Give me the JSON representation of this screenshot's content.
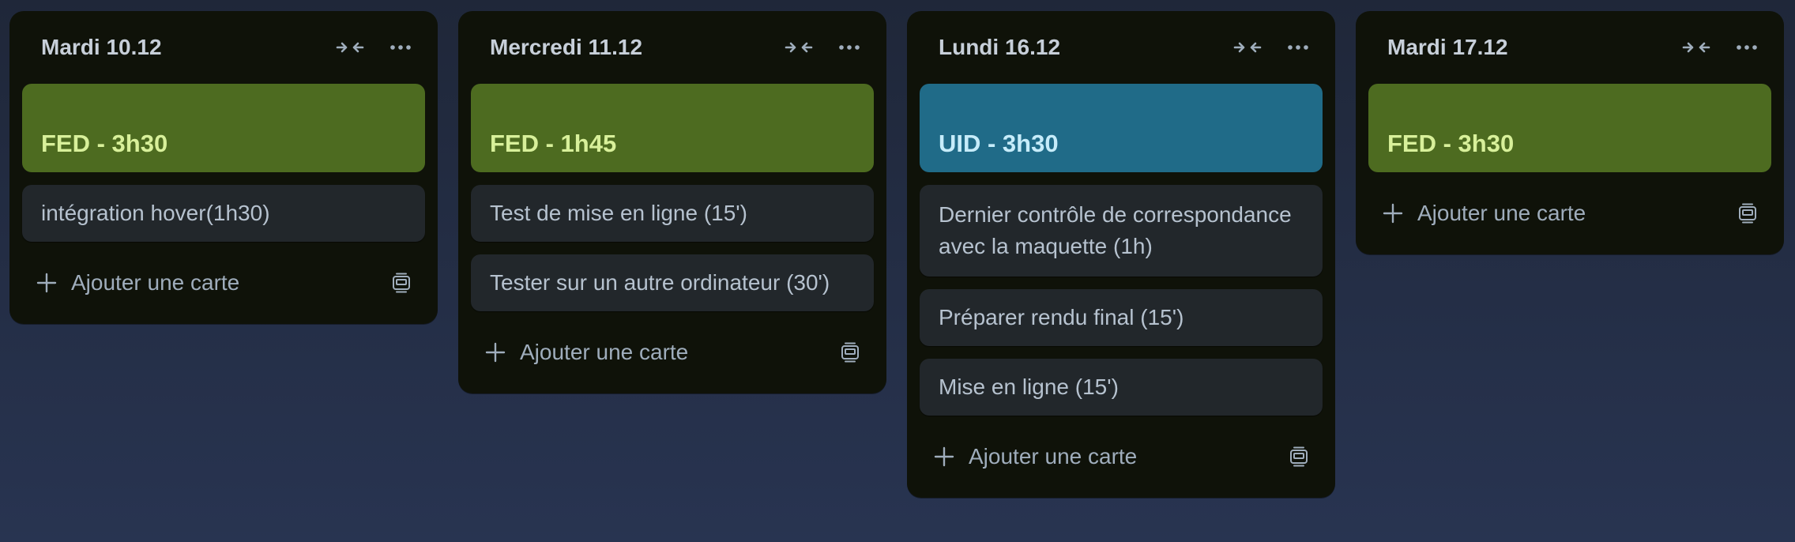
{
  "board": {
    "lists": [
      {
        "title": "Mardi 10.12",
        "cover": {
          "text": "FED - 3h30",
          "color": "green"
        },
        "cards": [
          "intégration hover(1h30)"
        ],
        "add_label": "Ajouter une carte"
      },
      {
        "title": "Mercredi 11.12",
        "cover": {
          "text": "FED - 1h45",
          "color": "green"
        },
        "cards": [
          "Test de mise en ligne (15')",
          "Tester sur un autre ordinateur (30')"
        ],
        "add_label": "Ajouter une carte"
      },
      {
        "title": "Lundi 16.12",
        "cover": {
          "text": "UID - 3h30",
          "color": "blue"
        },
        "cards": [
          "Dernier contrôle de correspondance avec la maquette (1h)",
          "Préparer rendu final (15')",
          "Mise en ligne (15')"
        ],
        "add_label": "Ajouter une carte"
      },
      {
        "title": "Mardi 17.12",
        "cover": {
          "text": "FED - 3h30",
          "color": "green"
        },
        "cards": [],
        "add_label": "Ajouter une carte"
      }
    ]
  },
  "colors": {
    "background": "#283451",
    "list_bg": "#0f1209",
    "card_bg": "#22272b",
    "green_label": "#4d6b20",
    "blue_label": "#206b88"
  },
  "icons": {
    "collapse": "collapse-arrows-icon",
    "more": "more-horizontal-icon",
    "add": "plus-icon",
    "template": "card-template-icon"
  }
}
